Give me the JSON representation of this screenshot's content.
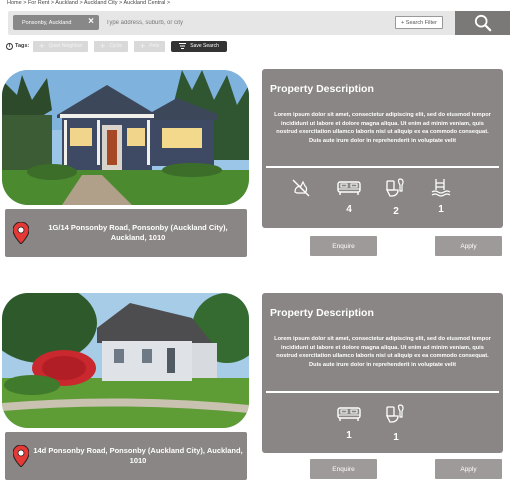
{
  "breadcrumb": "Home > For Rent > Auckland > Auckland City > Auckland Central >",
  "search": {
    "chip_label": "Ponsonby, Auckland",
    "placeholder": "Type address, suburb, or city",
    "filter_label": "+ Search Filter"
  },
  "tags": {
    "label": "Tags:",
    "buttons": [
      "Quiet Neighbor",
      "Cycle",
      "Pets"
    ],
    "save_label": "Save Search"
  },
  "listings": [
    {
      "address": "1G/14 Ponsonby Road, Ponsonby (Auckland City), Auckland, 1010",
      "title": "Property Description",
      "description": "Lorem ipsum dolor sit amet, consectetur adipiscing elit, sed do eiusmod tempor incididunt ut labore et dolore magna aliqua. Ut enim ad minim veniam, quis nostrud exercitation ullamco laboris nisi ut aliquip ex ea commodo consequat. Duis aute irure dolor in reprehenderit in voluptate velit",
      "features": {
        "bedrooms": "4",
        "bathrooms": "2",
        "pools": "1"
      },
      "enquire_label": "Enquire",
      "apply_label": "Apply"
    },
    {
      "address": "14d Ponsonby Road, Ponsonby (Auckland City), Auckland, 1010",
      "title": "Property Description",
      "description": "Lorem ipsum dolor sit amet, consectetur adipiscing elit, sed do eiusmod tempor incididunt ut labore et dolore magna aliqua. Ut enim ad minim veniam, quis nostrud exercitation ullamco laboris nisi ut aliquip ex ea commodo consequat. Duis aute irure dolor in reprehenderit in voluptate velit",
      "features": {
        "bedrooms": "1",
        "bathrooms": "1"
      },
      "enquire_label": "Enquire",
      "apply_label": "Apply"
    }
  ],
  "colors": {
    "card": "#8a8685",
    "button": "#9e9a99",
    "search_button": "#7b7878",
    "pin": "#e53935"
  }
}
